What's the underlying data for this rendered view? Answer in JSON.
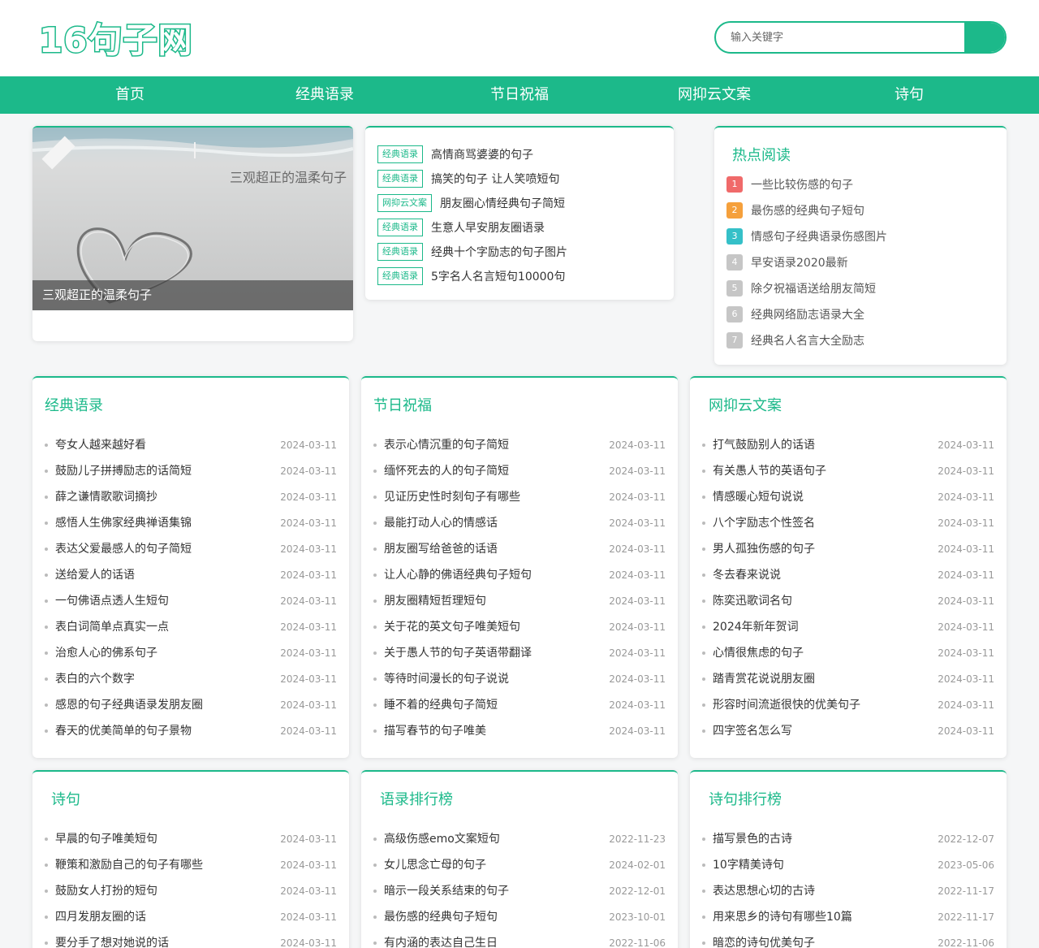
{
  "site": {
    "logo": "16句子网"
  },
  "search": {
    "placeholder": "输入关键字"
  },
  "nav": [
    "首页",
    "经典语录",
    "节日祝福",
    "网抑云文案",
    "诗句"
  ],
  "banner": {
    "caption": "三观超正的温柔句子",
    "overlay_title": "三观超正的温柔句子"
  },
  "featured": [
    {
      "tag": "经典语录",
      "title": "高情商骂婆婆的句子"
    },
    {
      "tag": "经典语录",
      "title": "搞笑的句子 让人笑喷短句"
    },
    {
      "tag": "网抑云文案",
      "title": "朋友圈心情经典句子简短"
    },
    {
      "tag": "经典语录",
      "title": "生意人早安朋友圈语录"
    },
    {
      "tag": "经典语录",
      "title": "经典十个字励志的句子图片"
    },
    {
      "tag": "经典语录",
      "title": "5字名人名言短句10000句"
    }
  ],
  "hot": {
    "title": "热点阅读",
    "items": [
      {
        "num": "1",
        "title": "一些比较伤感的句子",
        "color": "#f06a6a"
      },
      {
        "num": "2",
        "title": "最伤感的经典句子短句",
        "color": "#f5a03c"
      },
      {
        "num": "3",
        "title": "情感句子经典语录伤感图片",
        "color": "#35c0c8"
      },
      {
        "num": "4",
        "title": "早安语录2020最新",
        "color": "#c6c6c6"
      },
      {
        "num": "5",
        "title": "除夕祝福语送给朋友简短",
        "color": "#c6c6c6"
      },
      {
        "num": "6",
        "title": "经典网络励志语录大全",
        "color": "#c6c6c6"
      },
      {
        "num": "7",
        "title": "经典名人名言大全励志",
        "color": "#c6c6c6"
      }
    ]
  },
  "sections": [
    {
      "title": "经典语录",
      "items": [
        {
          "title": "夸女人越来越好看",
          "date": "2024-03-11"
        },
        {
          "title": "鼓励儿子拼搏励志的话简短",
          "date": "2024-03-11"
        },
        {
          "title": "薛之谦情歌歌词摘抄",
          "date": "2024-03-11"
        },
        {
          "title": "感悟人生佛家经典禅语集锦",
          "date": "2024-03-11"
        },
        {
          "title": "表达父爱最感人的句子简短",
          "date": "2024-03-11"
        },
        {
          "title": "送给爱人的话语",
          "date": "2024-03-11"
        },
        {
          "title": "一句佛语点透人生短句",
          "date": "2024-03-11"
        },
        {
          "title": "表白词简单点真实一点",
          "date": "2024-03-11"
        },
        {
          "title": "治愈人心的佛系句子",
          "date": "2024-03-11"
        },
        {
          "title": "表白的六个数字",
          "date": "2024-03-11"
        },
        {
          "title": "感恩的句子经典语录发朋友圈",
          "date": "2024-03-11"
        },
        {
          "title": "春天的优美简单的句子景物",
          "date": "2024-03-11"
        }
      ]
    },
    {
      "title": "节日祝福",
      "items": [
        {
          "title": "表示心情沉重的句子简短",
          "date": "2024-03-11"
        },
        {
          "title": "缅怀死去的人的句子简短",
          "date": "2024-03-11"
        },
        {
          "title": "见证历史性时刻句子有哪些",
          "date": "2024-03-11"
        },
        {
          "title": "最能打动人心的情感话",
          "date": "2024-03-11"
        },
        {
          "title": "朋友圈写给爸爸的话语",
          "date": "2024-03-11"
        },
        {
          "title": "让人心静的佛语经典句子短句",
          "date": "2024-03-11"
        },
        {
          "title": "朋友圈精短哲理短句",
          "date": "2024-03-11"
        },
        {
          "title": "关于花的英文句子唯美短句",
          "date": "2024-03-11"
        },
        {
          "title": "关于愚人节的句子英语带翻译",
          "date": "2024-03-11"
        },
        {
          "title": "等待时间漫长的句子说说",
          "date": "2024-03-11"
        },
        {
          "title": "睡不着的经典句子简短",
          "date": "2024-03-11"
        },
        {
          "title": "描写春节的句子唯美",
          "date": "2024-03-11"
        }
      ]
    },
    {
      "title": "网抑云文案",
      "items": [
        {
          "title": "打气鼓励别人的话语",
          "date": "2024-03-11"
        },
        {
          "title": "有关愚人节的英语句子",
          "date": "2024-03-11"
        },
        {
          "title": "情感暖心短句说说",
          "date": "2024-03-11"
        },
        {
          "title": "八个字励志个性签名",
          "date": "2024-03-11"
        },
        {
          "title": "男人孤独伤感的句子",
          "date": "2024-03-11"
        },
        {
          "title": "冬去春来说说",
          "date": "2024-03-11"
        },
        {
          "title": "陈奕迅歌词名句",
          "date": "2024-03-11"
        },
        {
          "title": "2024年新年贺词",
          "date": "2024-03-11"
        },
        {
          "title": "心情很焦虑的句子",
          "date": "2024-03-11"
        },
        {
          "title": "踏青赏花说说朋友圈",
          "date": "2024-03-11"
        },
        {
          "title": "形容时间流逝很快的优美句子",
          "date": "2024-03-11"
        },
        {
          "title": "四字签名怎么写",
          "date": "2024-03-11"
        }
      ]
    },
    {
      "title": "诗句",
      "items": [
        {
          "title": "早晨的句子唯美短句",
          "date": "2024-03-11"
        },
        {
          "title": "鞭策和激励自己的句子有哪些",
          "date": "2024-03-11"
        },
        {
          "title": "鼓励女人打扮的短句",
          "date": "2024-03-11"
        },
        {
          "title": "四月发朋友圈的话",
          "date": "2024-03-11"
        },
        {
          "title": "要分手了想对她说的话",
          "date": "2024-03-11"
        }
      ]
    },
    {
      "title": "语录排行榜",
      "items": [
        {
          "title": "高级伤感emo文案短句",
          "date": "2022-11-23"
        },
        {
          "title": "女儿思念亡母的句子",
          "date": "2024-02-01"
        },
        {
          "title": "暗示一段关系结束的句子",
          "date": "2022-12-01"
        },
        {
          "title": "最伤感的经典句子短句",
          "date": "2023-10-01"
        },
        {
          "title": "有内涵的表达自己生日",
          "date": "2022-11-06"
        }
      ]
    },
    {
      "title": "诗句排行榜",
      "items": [
        {
          "title": "描写景色的古诗",
          "date": "2022-12-07"
        },
        {
          "title": "10字精美诗句",
          "date": "2023-05-06"
        },
        {
          "title": "表达思想心切的古诗",
          "date": "2022-11-17"
        },
        {
          "title": "用来思乡的诗句有哪些10篇",
          "date": "2022-11-17"
        },
        {
          "title": "暗恋的诗句优美句子",
          "date": "2022-11-06"
        }
      ]
    }
  ]
}
